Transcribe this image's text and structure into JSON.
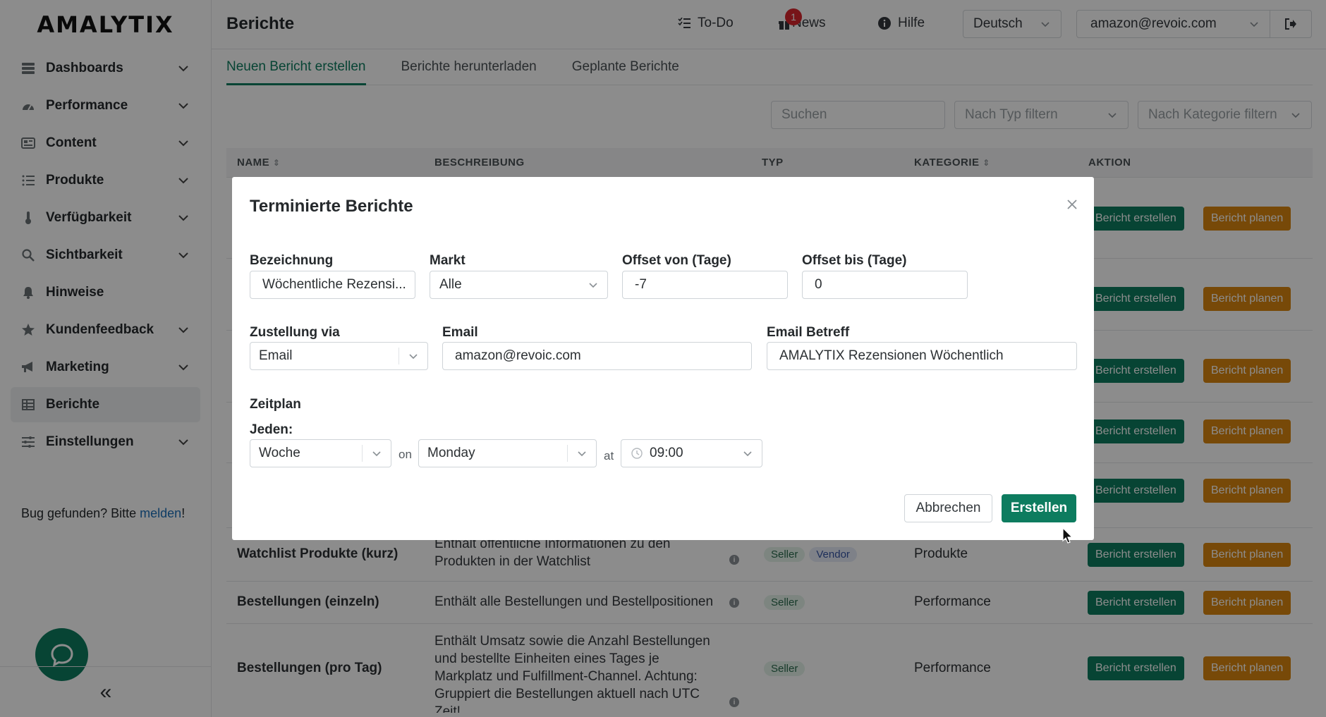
{
  "app": {
    "logo": "AMALYTIX"
  },
  "sidebar": {
    "items": [
      {
        "label": "Dashboards",
        "icon": "dashboard-icon"
      },
      {
        "label": "Performance",
        "icon": "gauge-icon"
      },
      {
        "label": "Content",
        "icon": "content-icon"
      },
      {
        "label": "Produkte",
        "icon": "list-icon"
      },
      {
        "label": "Verfügbarkeit",
        "icon": "thermometer-icon"
      },
      {
        "label": "Sichtbarkeit",
        "icon": "search-icon"
      },
      {
        "label": "Hinweise",
        "icon": "bell-icon"
      },
      {
        "label": "Kundenfeedback",
        "icon": "star-icon"
      },
      {
        "label": "Marketing",
        "icon": "megaphone-icon"
      },
      {
        "label": "Berichte",
        "icon": "table-icon"
      },
      {
        "label": "Einstellungen",
        "icon": "sliders-icon"
      }
    ],
    "bug_text": "Bug gefunden? Bitte ",
    "bug_link": "melden",
    "bug_suffix": "!",
    "collapse_label": "«"
  },
  "header": {
    "title": "Berichte",
    "todo": "To-Do",
    "news": "News",
    "news_count": "1",
    "help": "Hilfe",
    "language": "Deutsch",
    "account": "amazon@revoic.com"
  },
  "tabs": [
    {
      "label": "Neuen Bericht erstellen",
      "active": true
    },
    {
      "label": "Berichte herunterladen",
      "active": false
    },
    {
      "label": "Geplante Berichte",
      "active": false
    }
  ],
  "filters": {
    "search_placeholder": "Suchen",
    "type_placeholder": "Nach Typ filtern",
    "category_placeholder": "Nach Kategorie filtern"
  },
  "table": {
    "headers": {
      "name": "NAME",
      "description": "BESCHREIBUNG",
      "type": "TYP",
      "category": "KATEGORIE",
      "action": "AKTION"
    },
    "create_label": "Bericht erstellen",
    "plan_label": "Bericht planen",
    "rows": [
      {
        "name": "Watchlist Produkte (kurz)",
        "description": "Enthält öffentliche Informationen zu den Produkten in der Watchlist",
        "types": [
          "Seller",
          "Vendor"
        ],
        "category": "Produkte"
      },
      {
        "name": "Bestellungen (einzeln)",
        "description": "Enthält alle Bestellungen und Bestellpositionen",
        "types": [
          "Seller"
        ],
        "category": "Performance"
      },
      {
        "name": "Bestellungen (pro Tag)",
        "description": "Enthält Umsatz sowie die Anzahl Bestellungen und bestellte Einheiten eines Tages je Markplatz und Fulfillment-Channel. Achtung: Gruppiert die Bestellungen aktuell nach UTC Zeit!",
        "types": [
          "Seller"
        ],
        "category": "Performance"
      }
    ]
  },
  "modal": {
    "title": "Terminierte Berichte",
    "fields": {
      "bezeichnung_label": "Bezeichnung",
      "bezeichnung_value": "Wöchentliche Rezensi...",
      "markt_label": "Markt",
      "markt_value": "Alle",
      "offset_von_label": "Offset von (Tage)",
      "offset_von_value": "-7",
      "offset_bis_label": "Offset bis (Tage)",
      "offset_bis_value": "0",
      "zustellung_label": "Zustellung via",
      "zustellung_value": "Email",
      "email_label": "Email",
      "email_value": "amazon@revoic.com",
      "betreff_label": "Email Betreff",
      "betreff_value": "AMALYTIX Rezensionen Wöchentlich"
    },
    "schedule": {
      "section_label": "Zeitplan",
      "every_label": "Jeden:",
      "interval_value": "Woche",
      "on_word": "on",
      "day_value": "Monday",
      "at_word": "at",
      "time_value": "09:00"
    },
    "cancel_label": "Abbrechen",
    "submit_label": "Erstellen"
  },
  "colors": {
    "accent": "#0d7c5f",
    "plan": "#d9860f",
    "badge": "#d9262c"
  }
}
